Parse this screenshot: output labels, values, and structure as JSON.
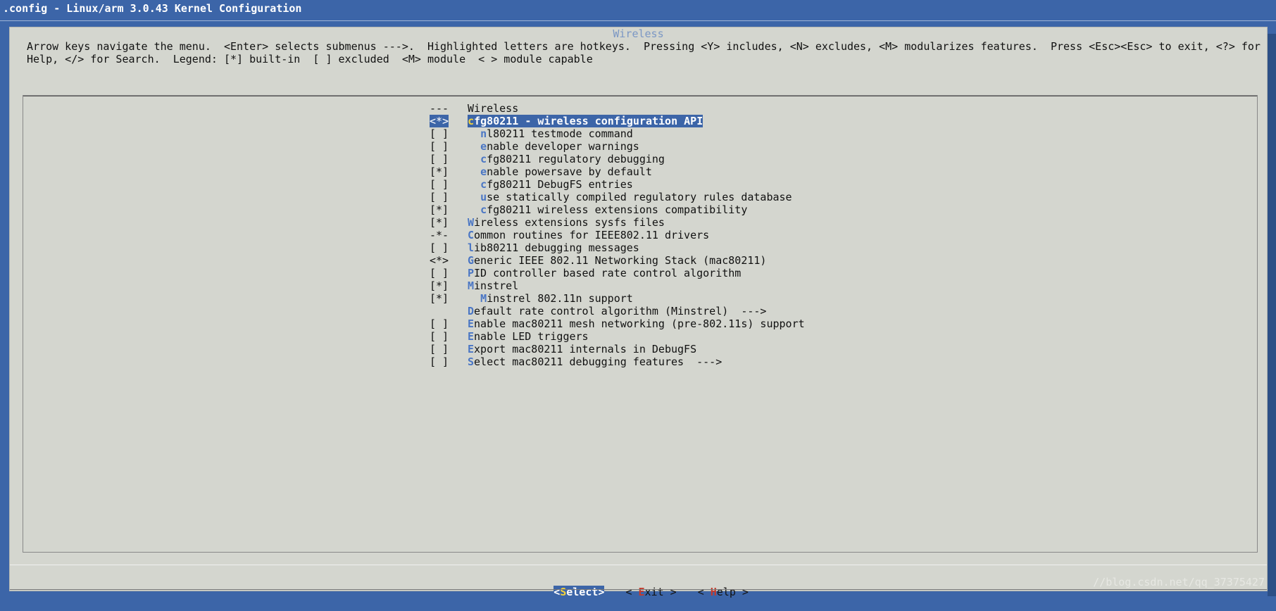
{
  "window": {
    "title": ".config - Linux/arm 3.0.43 Kernel Configuration"
  },
  "dialog": {
    "title": "Wireless",
    "help_line1": "Arrow keys navigate the menu.  <Enter> selects submenus --->.  Highlighted letters are hotkeys.  Pressing <Y> includes, <N> excludes, <M> modularizes features.  Press <Esc><Esc> to exit, <?> for",
    "help_line2": "Help, </> for Search.  Legend: [*] built-in  [ ] excluded  <M> module  < > module capable"
  },
  "menu": {
    "items": [
      {
        "mark": "---",
        "indent": "",
        "hotkey": "",
        "rest": "Wireless",
        "selected": false
      },
      {
        "mark": "<*>",
        "indent": "",
        "hotkey": "c",
        "rest": "fg80211 - wireless configuration API",
        "selected": true
      },
      {
        "mark": "[ ]",
        "indent": "  ",
        "hotkey": "n",
        "rest": "l80211 testmode command",
        "selected": false
      },
      {
        "mark": "[ ]",
        "indent": "  ",
        "hotkey": "e",
        "rest": "nable developer warnings",
        "selected": false
      },
      {
        "mark": "[ ]",
        "indent": "  ",
        "hotkey": "c",
        "rest": "fg80211 regulatory debugging",
        "selected": false
      },
      {
        "mark": "[*]",
        "indent": "  ",
        "hotkey": "e",
        "rest": "nable powersave by default",
        "selected": false
      },
      {
        "mark": "[ ]",
        "indent": "  ",
        "hotkey": "c",
        "rest": "fg80211 DebugFS entries",
        "selected": false
      },
      {
        "mark": "[ ]",
        "indent": "  ",
        "hotkey": "u",
        "rest": "se statically compiled regulatory rules database",
        "selected": false
      },
      {
        "mark": "[*]",
        "indent": "  ",
        "hotkey": "c",
        "rest": "fg80211 wireless extensions compatibility",
        "selected": false
      },
      {
        "mark": "[*]",
        "indent": "",
        "hotkey": "W",
        "rest": "ireless extensions sysfs files",
        "selected": false
      },
      {
        "mark": "-*-",
        "indent": "",
        "hotkey": "C",
        "rest": "ommon routines for IEEE802.11 drivers",
        "selected": false
      },
      {
        "mark": "[ ]",
        "indent": "",
        "hotkey": "l",
        "rest": "ib80211 debugging messages",
        "selected": false
      },
      {
        "mark": "<*>",
        "indent": "",
        "hotkey": "G",
        "rest": "eneric IEEE 802.11 Networking Stack (mac80211)",
        "selected": false
      },
      {
        "mark": "[ ]",
        "indent": "",
        "hotkey": "P",
        "rest": "ID controller based rate control algorithm",
        "selected": false
      },
      {
        "mark": "[*]",
        "indent": "",
        "hotkey": "M",
        "rest": "instrel",
        "selected": false
      },
      {
        "mark": "[*]",
        "indent": "  ",
        "hotkey": "M",
        "rest": "instrel 802.11n support",
        "selected": false
      },
      {
        "mark": "",
        "indent": "",
        "hotkey": "D",
        "rest": "efault rate control algorithm (Minstrel)  --->",
        "selected": false
      },
      {
        "mark": "[ ]",
        "indent": "",
        "hotkey": "E",
        "rest": "nable mac80211 mesh networking (pre-802.11s) support",
        "selected": false
      },
      {
        "mark": "[ ]",
        "indent": "",
        "hotkey": "E",
        "rest": "nable LED triggers",
        "selected": false
      },
      {
        "mark": "[ ]",
        "indent": "",
        "hotkey": "E",
        "rest": "xport mac80211 internals in DebugFS",
        "selected": false
      },
      {
        "mark": "[ ]",
        "indent": "",
        "hotkey": "S",
        "rest": "elect mac80211 debugging features  --->",
        "selected": false
      }
    ]
  },
  "buttons": {
    "select": {
      "pre": "<",
      "hotkey": "S",
      "post": "elect>"
    },
    "exit": {
      "pre": "< ",
      "hotkey": "E",
      "post": "xit >"
    },
    "help": {
      "pre": "< ",
      "hotkey": "H",
      "post": "elp >"
    }
  },
  "watermark": "//blog.csdn.net/qq_37375427",
  "colors": {
    "background_blue": "#3c65a8",
    "dialog_grey": "#d4d6cf",
    "hotkey_blue": "#4a76c4",
    "hotkey_red": "#c43a2c",
    "hotkey_selected_yellow": "#f2d23b"
  }
}
